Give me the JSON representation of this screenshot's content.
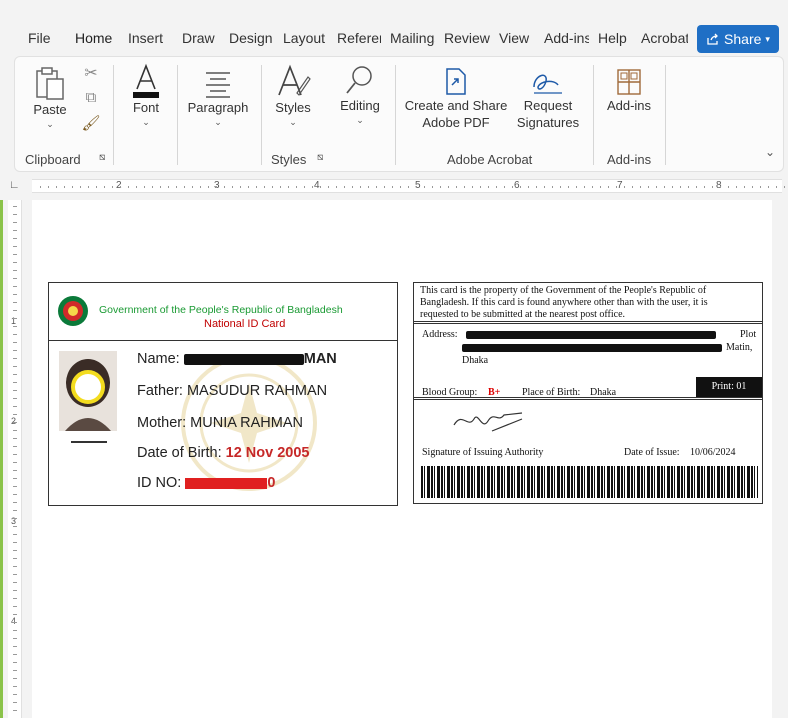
{
  "ribbon_tabs": [
    {
      "label": "File",
      "active": false
    },
    {
      "label": "Home",
      "active": true
    },
    {
      "label": "Insert",
      "active": false
    },
    {
      "label": "Draw",
      "active": false
    },
    {
      "label": "Design",
      "active": false
    },
    {
      "label": "Layout",
      "active": false
    },
    {
      "label": "References",
      "active": false
    },
    {
      "label": "Mailings",
      "active": false
    },
    {
      "label": "Review",
      "active": false
    },
    {
      "label": "View",
      "active": false
    },
    {
      "label": "Add-ins",
      "active": false
    },
    {
      "label": "Help",
      "active": false
    },
    {
      "label": "Acrobat",
      "active": false
    }
  ],
  "share_label": "Share",
  "ribbon": {
    "paste": "Paste",
    "font": "Font",
    "paragraph": "Paragraph",
    "styles": "Styles",
    "editing": "Editing",
    "create_pdf_line1": "Create and Share",
    "create_pdf_line2": "Adobe PDF",
    "request_sig_line1": "Request",
    "request_sig_line2": "Signatures",
    "addins": "Add-ins",
    "groups": {
      "clipboard": "Clipboard",
      "styles": "Styles",
      "acrobat": "Adobe Acrobat",
      "addins": "Add-ins"
    }
  },
  "ruler_numbers": [
    "2",
    "3",
    "4",
    "5",
    "6",
    "7",
    "8"
  ],
  "vruler_numbers": [
    "1",
    "2",
    "3",
    "4"
  ],
  "id_front": {
    "header_line1": "Government of the People's Republic of Bangladesh",
    "header_line2": "National ID Card",
    "photo_caption": "",
    "name_label": "Name:",
    "name_value_tail": "MAN",
    "father_label": "Father:",
    "father_value": "MASUDUR RAHMAN",
    "mother_label": "Mother:",
    "mother_value": "MUNIA RAHMAN",
    "dob_label": "Date of Birth:",
    "dob_value": "12 Nov 2005",
    "idno_label": "ID NO:",
    "idno_value_tail": "0"
  },
  "id_back": {
    "notice_line1": "This card is the property of the Government of the People's Republic of",
    "notice_line2": "Bangladesh. If this card is found anywhere other than with the user, it is",
    "notice_line3": "requested to be submitted at the nearest post office.",
    "address_label": "Address:",
    "address_city": "Dhaka",
    "address_tail1": "Plot",
    "address_tail2": "Matin,",
    "blood_label": "Blood Group:",
    "blood_value": "B+",
    "pob_label": "Place of Birth:",
    "pob_value": "Dhaka",
    "print_label": "Print: 01",
    "signature_label": "Signature of Issuing Authority",
    "issue_label": "Date of Issue:",
    "issue_value": "10/06/2024"
  },
  "colors": {
    "accent": "#185abd",
    "share": "#1f6fc5",
    "header_green": "#1a9a33",
    "header_red": "#c00000"
  }
}
